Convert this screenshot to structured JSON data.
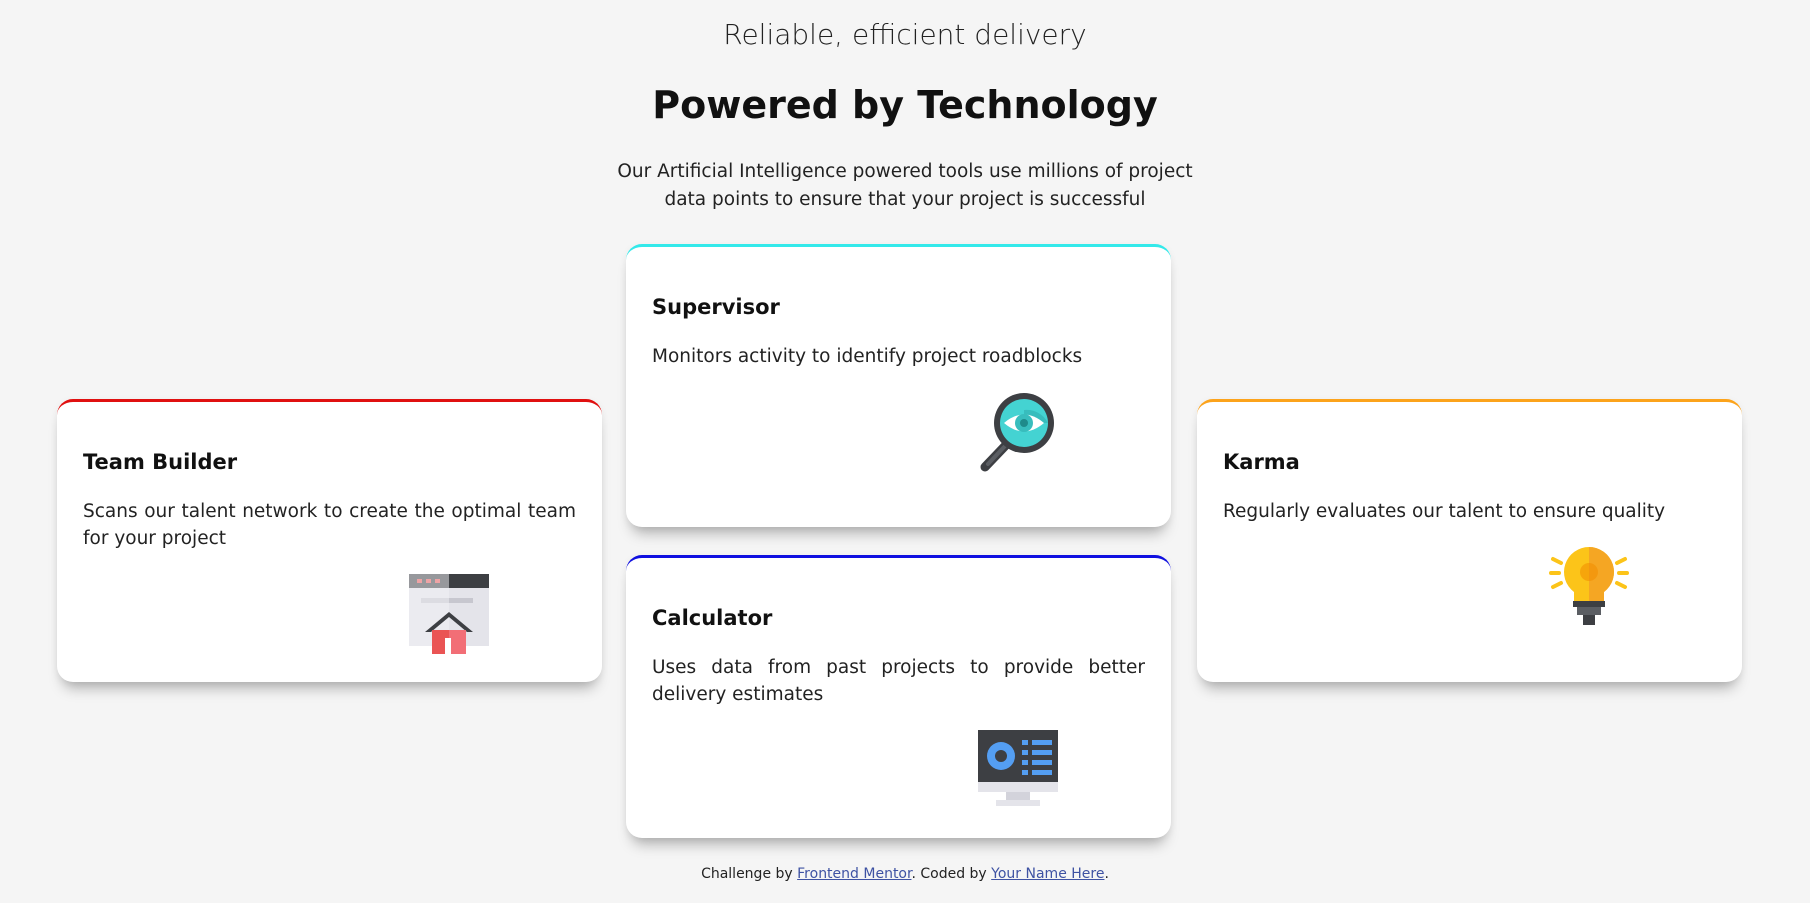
{
  "header": {
    "subtitle": "Reliable, efficient delivery",
    "title": "Powered by Technology",
    "intro": "Our Artificial Intelligence powered tools use millions of project data points to ensure that your project is successful"
  },
  "cards": [
    {
      "title": "Supervisor",
      "description": "Monitors activity to identify project roadblocks",
      "icon": "magnifier-eye-icon",
      "accent": "#44d3d2"
    },
    {
      "title": "Team Builder",
      "description": "Scans our talent network to create the optimal team for your project",
      "icon": "team-builder-icon",
      "accent": "#ea5454"
    },
    {
      "title": "Karma",
      "description": "Regularly evaluates our talent to ensure quality",
      "icon": "lightbulb-icon",
      "accent": "#fcae4a"
    },
    {
      "title": "Calculator",
      "description": "Uses data from past projects to provide better delivery estimates",
      "icon": "calculator-monitor-icon",
      "accent": "#549ef2"
    }
  ],
  "footer": {
    "prefix": "Challenge by ",
    "link1": "Frontend Mentor",
    "middle": ". Coded by ",
    "link2": "Your Name Here",
    "suffix": "."
  }
}
